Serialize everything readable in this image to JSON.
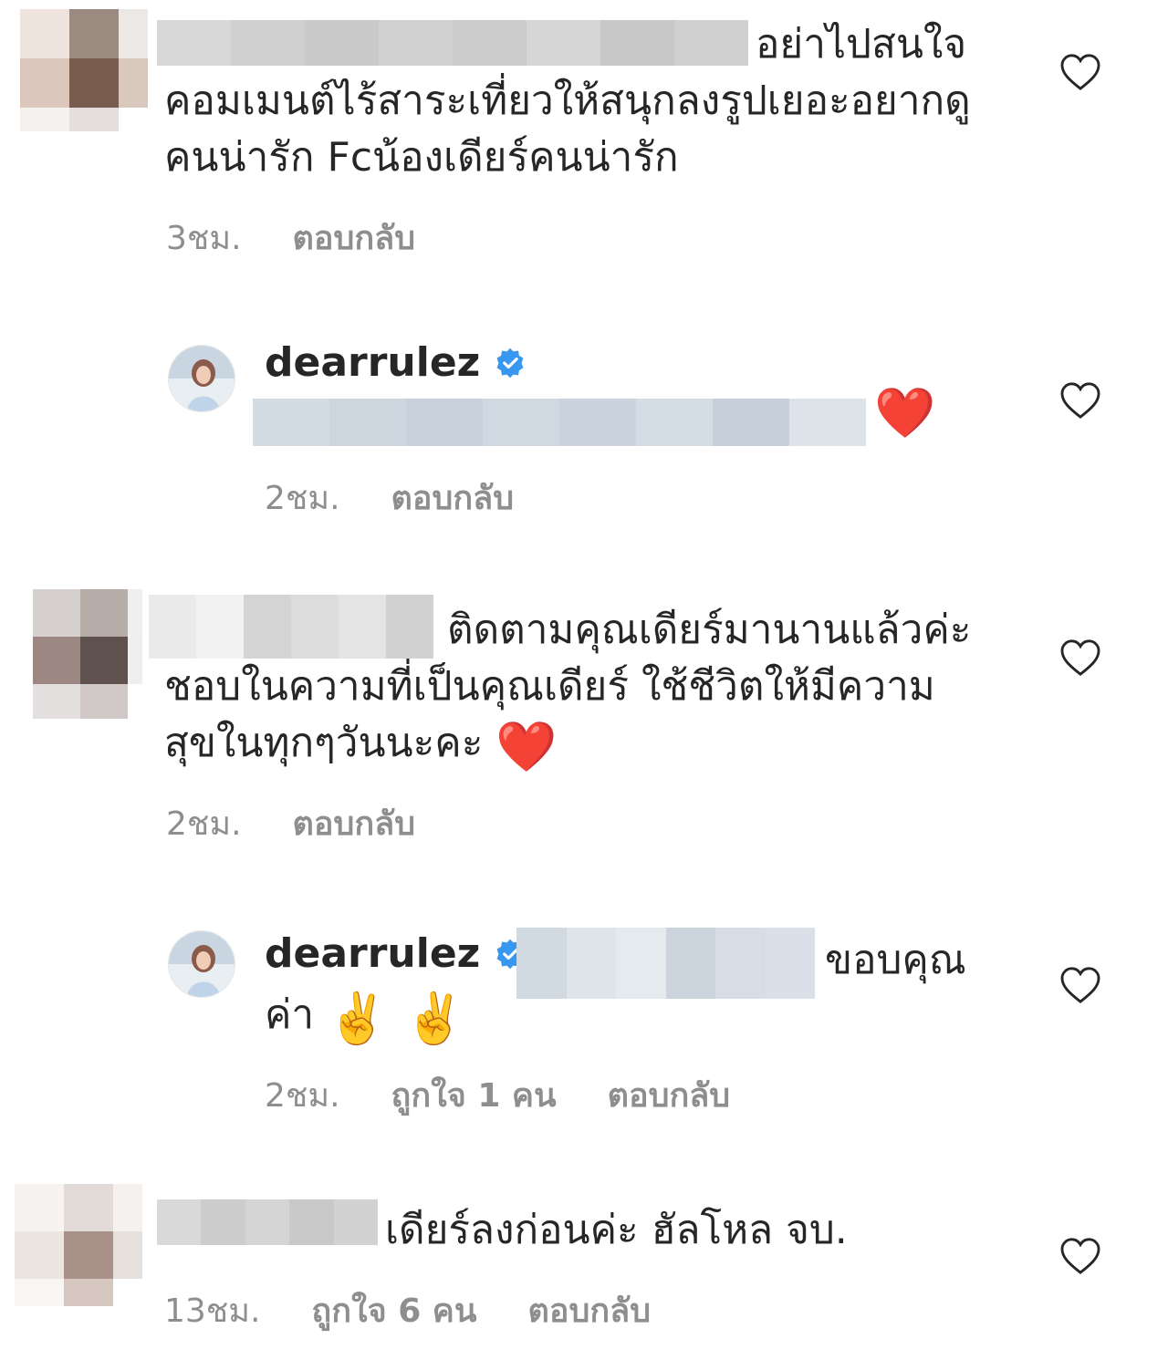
{
  "comments": [
    {
      "text_line1": "อย่าไปสนใจ",
      "text_rest": "คอมเมนต์ไร้สาระเที่ยวให้สนุกลงรูปเยอะอยากดูคนน่ารัก  Fcน้องเดียร์คนน่ารัก",
      "time": "3ชม.",
      "reply_label": "ตอบกลับ"
    },
    {
      "username": "dearrulez",
      "emoji": "❤️",
      "time": "2ชม.",
      "reply_label": "ตอบกลับ"
    },
    {
      "text_line1": "ติดตามคุณเดียร์มานานแล้วค่ะ",
      "text_rest": "ชอบในความที่เป็นคุณเดียร์ ใช้ชีวิตให้มีความสุขในทุกๆวันนะคะ",
      "emoji": "❤️",
      "time": "2ชม.",
      "reply_label": "ตอบกลับ"
    },
    {
      "username": "dearrulez",
      "text_after_mention": "ขอบคุณ",
      "text_line2": "ค่า",
      "emoji": "✌️ ✌️",
      "time": "2ชม.",
      "likes": "ถูกใจ 1 คน",
      "reply_label": "ตอบกลับ"
    },
    {
      "text_line1": "เดียร์ลงก่อนค่ะ ฮัลโหล จบ.",
      "time": "13ชม.",
      "likes": "ถูกใจ 6 คน",
      "reply_label": "ตอบกลับ"
    }
  ],
  "icons": {
    "like": "heart-outline-icon",
    "verified": "verified-badge-icon"
  },
  "colors": {
    "text": "#262626",
    "meta": "#8e8e8e",
    "verified": "#3897f0",
    "heart_emoji": "#e0262e"
  }
}
